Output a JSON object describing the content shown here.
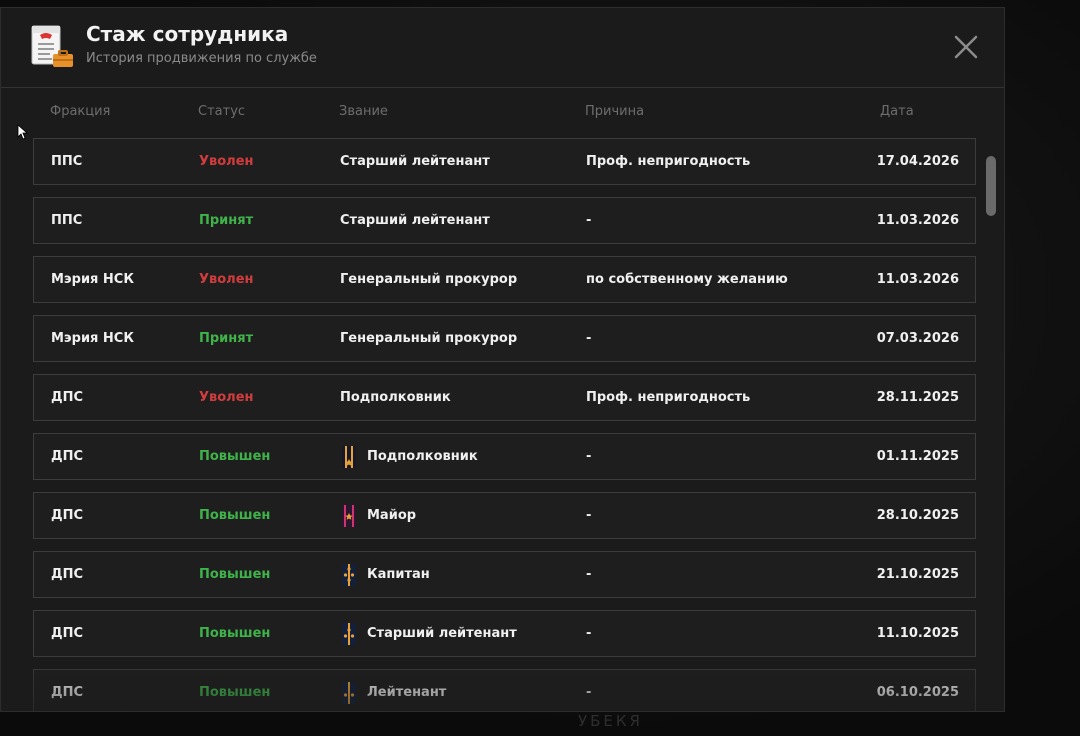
{
  "background_text": "УБЕКЯ",
  "header": {
    "title": "Стаж сотрудника",
    "subtitle": "История продвижения по службе",
    "icon": "document-briefcase-icon",
    "close_icon": "close-icon"
  },
  "columns": {
    "faction": "Фракция",
    "status": "Статус",
    "rank": "Звание",
    "reason": "Причина",
    "date": "Дата"
  },
  "colors": {
    "status_fired": "#d13d3d",
    "status_hired": "#3fb34a",
    "status_promoted": "#3fb34a"
  },
  "rows": [
    {
      "faction": "ППС",
      "status": "Уволен",
      "status_type": "fired",
      "rank": "Старший лейтенант",
      "rank_icon": "",
      "reason": "Проф. непригодность",
      "date": "17.04.2026"
    },
    {
      "faction": "ППС",
      "status": "Принят",
      "status_type": "hired",
      "rank": "Старший лейтенант",
      "rank_icon": "",
      "reason": "-",
      "date": "11.03.2026"
    },
    {
      "faction": "Мэрия НСК",
      "status": "Уволен",
      "status_type": "fired",
      "rank": "Генеральный прокурор",
      "rank_icon": "",
      "reason": "по собственному желанию",
      "date": "11.03.2026"
    },
    {
      "faction": "Мэрия НСК",
      "status": "Принят",
      "status_type": "hired",
      "rank": "Генеральный прокурор",
      "rank_icon": "",
      "reason": "-",
      "date": "07.03.2026"
    },
    {
      "faction": "ДПС",
      "status": "Уволен",
      "status_type": "fired",
      "rank": "Подполковник",
      "rank_icon": "",
      "reason": "Проф. непригодность",
      "date": "28.11.2025"
    },
    {
      "faction": "ДПС",
      "status": "Повышен",
      "status_type": "promoted",
      "rank": "Подполковник",
      "rank_icon": "lieutenant-colonel-shoulder-strap-icon",
      "reason": "-",
      "date": "01.11.2025"
    },
    {
      "faction": "ДПС",
      "status": "Повышен",
      "status_type": "promoted",
      "rank": "Майор",
      "rank_icon": "major-shoulder-strap-icon",
      "reason": "-",
      "date": "28.10.2025"
    },
    {
      "faction": "ДПС",
      "status": "Повышен",
      "status_type": "promoted",
      "rank": "Капитан",
      "rank_icon": "captain-shoulder-strap-icon",
      "reason": "-",
      "date": "21.10.2025"
    },
    {
      "faction": "ДПС",
      "status": "Повышен",
      "status_type": "promoted",
      "rank": "Старший лейтенант",
      "rank_icon": "senior-lieutenant-shoulder-strap-icon",
      "reason": "-",
      "date": "11.10.2025"
    },
    {
      "faction": "ДПС",
      "status": "Повышен",
      "status_type": "promoted",
      "rank": "Лейтенант",
      "rank_icon": "lieutenant-shoulder-strap-icon",
      "reason": "-",
      "date": "06.10.2025"
    }
  ]
}
